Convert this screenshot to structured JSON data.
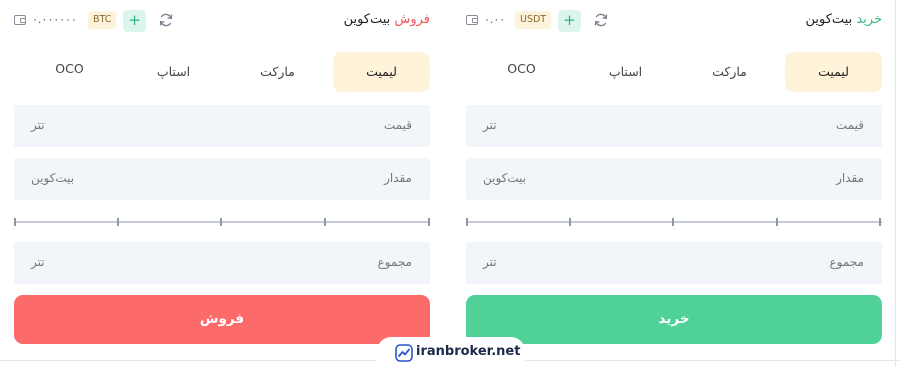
{
  "sell_panel": {
    "title_asset": "بیت‌کوین",
    "title_verb": "فروش",
    "balance": "۰.۰۰۰۰۰۰",
    "coin_badge": "BTC",
    "plus_label": "+",
    "tabs": [
      "لیمیت",
      "مارکت",
      "استاپ",
      "OCO"
    ],
    "active_tab": "لیمیت",
    "price_label": "قیمت",
    "price_unit": "تتر",
    "amount_label": "مقدار",
    "amount_unit": "بیت‌کوین",
    "total_label": "مجموع",
    "total_unit": "تتر",
    "slider_value_percent": 0,
    "button_label": "فروش",
    "button_color": "#fd6a6a"
  },
  "buy_panel": {
    "title_asset": "بیت‌کوین",
    "title_verb": "خرید",
    "balance": "۰.۰۰",
    "coin_badge": "USDT",
    "plus_label": "+",
    "tabs": [
      "لیمیت",
      "مارکت",
      "استاپ",
      "OCO"
    ],
    "active_tab": "لیمیت",
    "price_label": "قیمت",
    "price_unit": "تتر",
    "amount_label": "مقدار",
    "amount_unit": "بیت‌کوین",
    "total_label": "مجموع",
    "total_unit": "تتر",
    "slider_value_percent": 0,
    "button_label": "خرید",
    "button_color": "#4fd197"
  },
  "icons": {
    "wallet": "wallet-icon",
    "refresh": "refresh-icon",
    "plus": "plus-icon",
    "logo": "iranbroker-logo-icon"
  },
  "watermark": {
    "text": "iranbroker.net"
  },
  "colors": {
    "sell_accent": "#f0585a",
    "buy_accent": "#38b97c",
    "active_tab_bg": "#fef3d9",
    "input_bg": "#f2f5fa",
    "badge_bg": "#fdf3dc",
    "plus_bg": "#dcf6ee"
  }
}
